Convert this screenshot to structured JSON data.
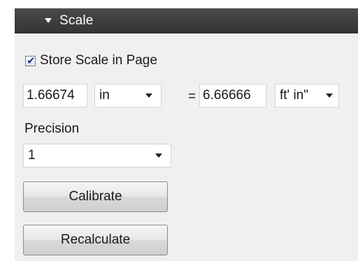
{
  "header": {
    "title": "Scale",
    "collapse_icon": "triangle-down-icon"
  },
  "store_scale": {
    "label": "Store Scale in Page",
    "checked": true
  },
  "scale": {
    "page_value": "1.66674",
    "page_unit": "in",
    "equals": "=",
    "real_value": "6.66666",
    "real_unit": "ft' in\""
  },
  "precision": {
    "label": "Precision",
    "value": "1"
  },
  "buttons": {
    "calibrate": "Calibrate",
    "recalculate": "Recalculate"
  },
  "colors": {
    "header_bg": "#3c3c3c",
    "panel_bg": "#f0f0f0",
    "checkmark": "#22347a"
  }
}
